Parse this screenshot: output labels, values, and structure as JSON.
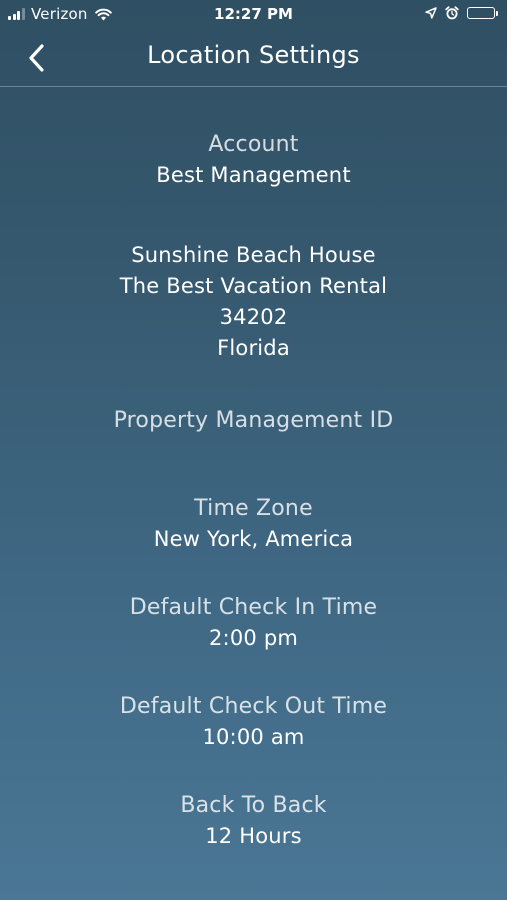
{
  "status_bar": {
    "carrier": "Verizon",
    "time": "12:27 PM",
    "signal_bars_filled": 3,
    "signal_bars_total": 4,
    "battery_level": 1.0,
    "icons": [
      "signal-icon",
      "wifi-icon",
      "location-arrow-icon",
      "alarm-icon",
      "battery-icon"
    ]
  },
  "header": {
    "back_icon": "chevron-left-icon",
    "title": "Location Settings"
  },
  "account": {
    "label": "Account",
    "value": "Best Management"
  },
  "property": {
    "name": "Sunshine Beach House",
    "company": "The Best Vacation Rental",
    "zip": "34202",
    "state": "Florida"
  },
  "property_management_id": {
    "label": "Property Management ID",
    "value": ""
  },
  "time_zone": {
    "label": "Time Zone",
    "value": "New York, America"
  },
  "check_in": {
    "label": "Default Check In Time",
    "value": "2:00 pm"
  },
  "check_out": {
    "label": "Default Check Out Time",
    "value": "10:00 am"
  },
  "back_to_back": {
    "label": "Back To Back",
    "value": "12 Hours"
  },
  "colors": {
    "background_top": "#2f4f63",
    "background_bottom": "#4a7795",
    "text": "#ffffff"
  }
}
